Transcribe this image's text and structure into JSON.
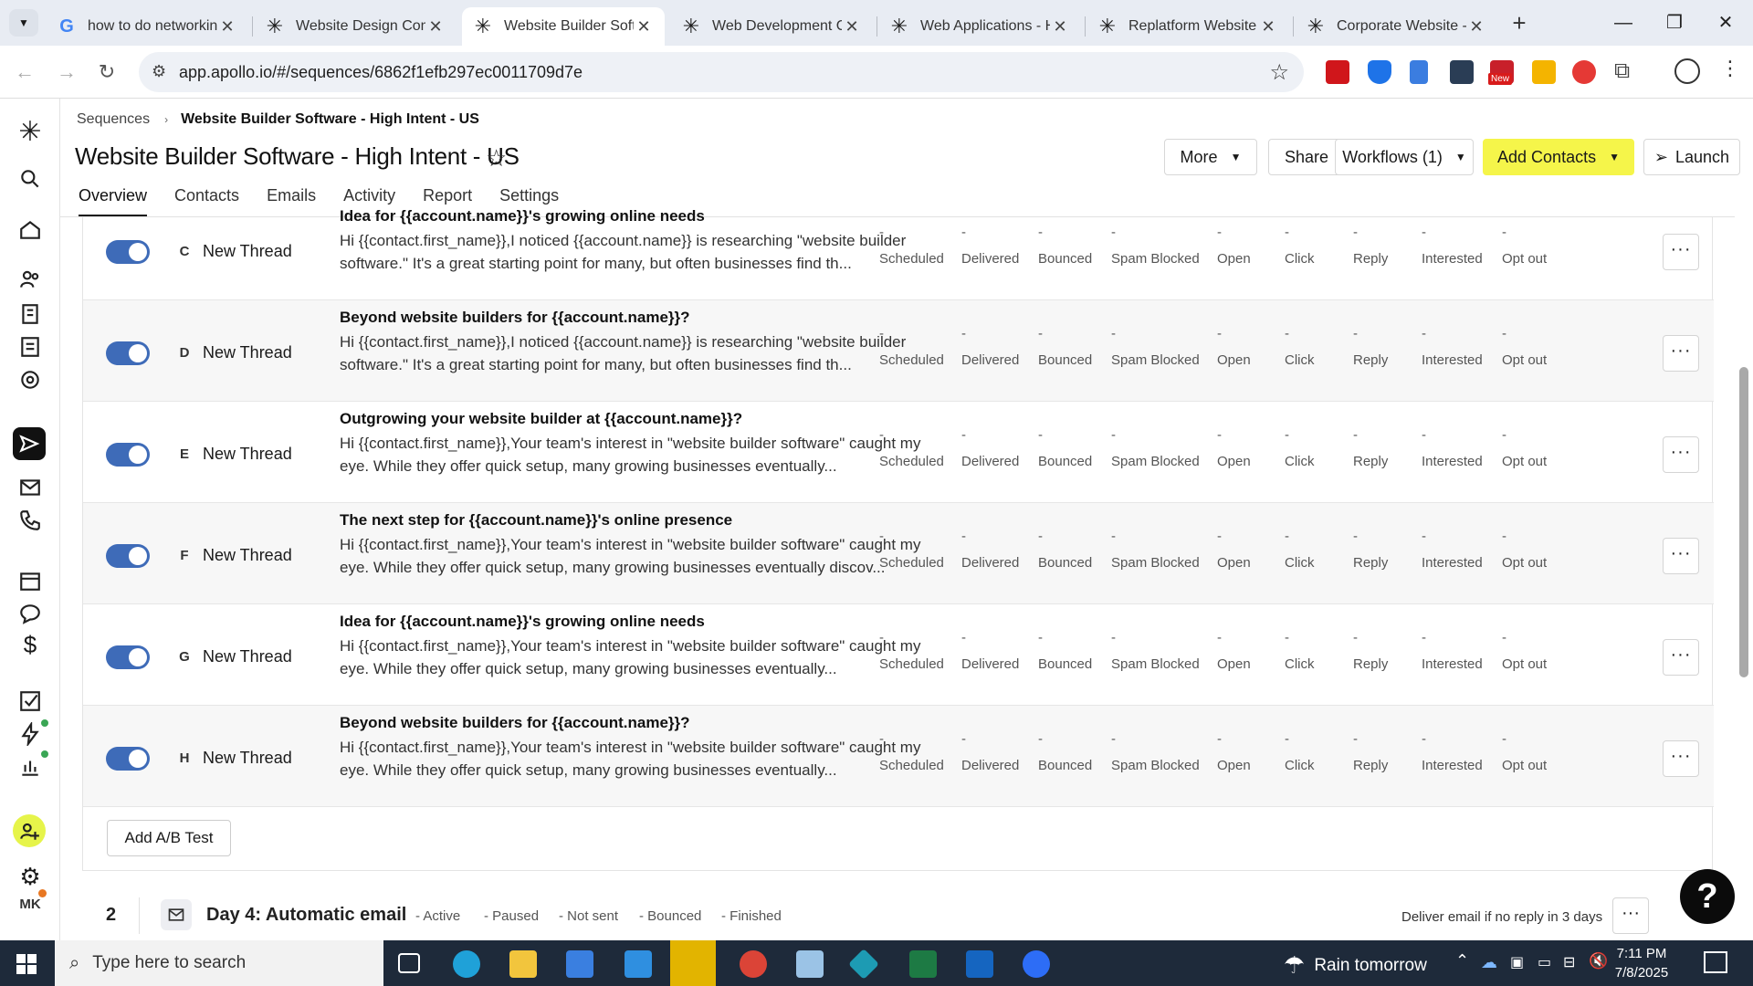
{
  "browser": {
    "tabs": [
      {
        "title": "how to do networking",
        "favicon": "google-icon",
        "active": false
      },
      {
        "title": "Website Design Com",
        "favicon": "apollo-icon",
        "active": false
      },
      {
        "title": "Website Builder Softw",
        "favicon": "apollo-icon",
        "active": true
      },
      {
        "title": "Web Development C",
        "favicon": "apollo-icon",
        "active": false
      },
      {
        "title": "Web Applications - H",
        "favicon": "apollo-icon",
        "active": false
      },
      {
        "title": "Replatform Website",
        "favicon": "apollo-icon",
        "active": false
      },
      {
        "title": "Corporate Website -",
        "favicon": "apollo-icon",
        "active": false
      }
    ],
    "url": "app.apollo.io/#/sequences/6862f1efb297ec0011709d7e",
    "new_badge": "New"
  },
  "header": {
    "breadcrumb_root": "Sequences",
    "breadcrumb_current": "Website Builder Software - High Intent - US",
    "title": "Website Builder Software - High Intent - US",
    "buttons": {
      "more": "More",
      "share": "Share",
      "workflows": "Workflows (1)",
      "add_contacts": "Add Contacts",
      "launch": "Launch"
    },
    "tabs": [
      "Overview",
      "Contacts",
      "Emails",
      "Activity",
      "Report",
      "Settings"
    ]
  },
  "stat_labels": [
    "Scheduled",
    "Delivered",
    "Bounced",
    "Spam Blocked",
    "Open",
    "Click",
    "Reply",
    "Interested",
    "Opt out"
  ],
  "stat_value": "-",
  "variants": [
    {
      "letter": "C",
      "thread": "New Thread",
      "subject": "Idea for {{account.name}}'s growing online needs",
      "body": "Hi {{contact.first_name}},I noticed {{account.name}} is researching \"website builder software.\" It's a great starting point for many, but often businesses find th..."
    },
    {
      "letter": "D",
      "thread": "New Thread",
      "subject": "Beyond website builders for {{account.name}}?",
      "body": "Hi {{contact.first_name}},I noticed {{account.name}} is researching \"website builder software.\" It's a great starting point for many, but often businesses find th..."
    },
    {
      "letter": "E",
      "thread": "New Thread",
      "subject": "Outgrowing your website builder at {{account.name}}?",
      "body": "Hi {{contact.first_name}},Your team's interest in \"website builder software\" caught my eye. While they offer quick setup, many growing businesses eventually..."
    },
    {
      "letter": "F",
      "thread": "New Thread",
      "subject": "The next step for {{account.name}}'s online presence",
      "body": "Hi {{contact.first_name}},Your team's interest in \"website builder software\" caught my eye. While they offer quick setup, many growing businesses eventually discov..."
    },
    {
      "letter": "G",
      "thread": "New Thread",
      "subject": "Idea for {{account.name}}'s growing online needs",
      "body": "Hi {{contact.first_name}},Your team's interest in \"website builder software\" caught my eye. While they offer quick setup, many growing businesses eventually..."
    },
    {
      "letter": "H",
      "thread": "New Thread",
      "subject": "Beyond website builders for {{account.name}}?",
      "body": "Hi {{contact.first_name}},Your team's interest in \"website builder software\" caught my eye. While they offer quick setup, many growing businesses eventually..."
    }
  ],
  "add_ab_test": "Add A/B Test",
  "step": {
    "number": "2",
    "title": "Day 4: Automatic email",
    "stats": [
      "- Active",
      "- Paused",
      "- Not sent",
      "- Bounced",
      "- Finished"
    ],
    "deliver_note": "Deliver email if no reply in 3 days"
  },
  "user_initials": "MK",
  "taskbar": {
    "search_placeholder": "Type here to search",
    "weather": "Rain tomorrow",
    "time": "7:11 PM",
    "date": "7/8/2025"
  },
  "colors": {
    "accent_yellow": "#f5f54a",
    "toggle_blue": "#3e6bb8"
  }
}
